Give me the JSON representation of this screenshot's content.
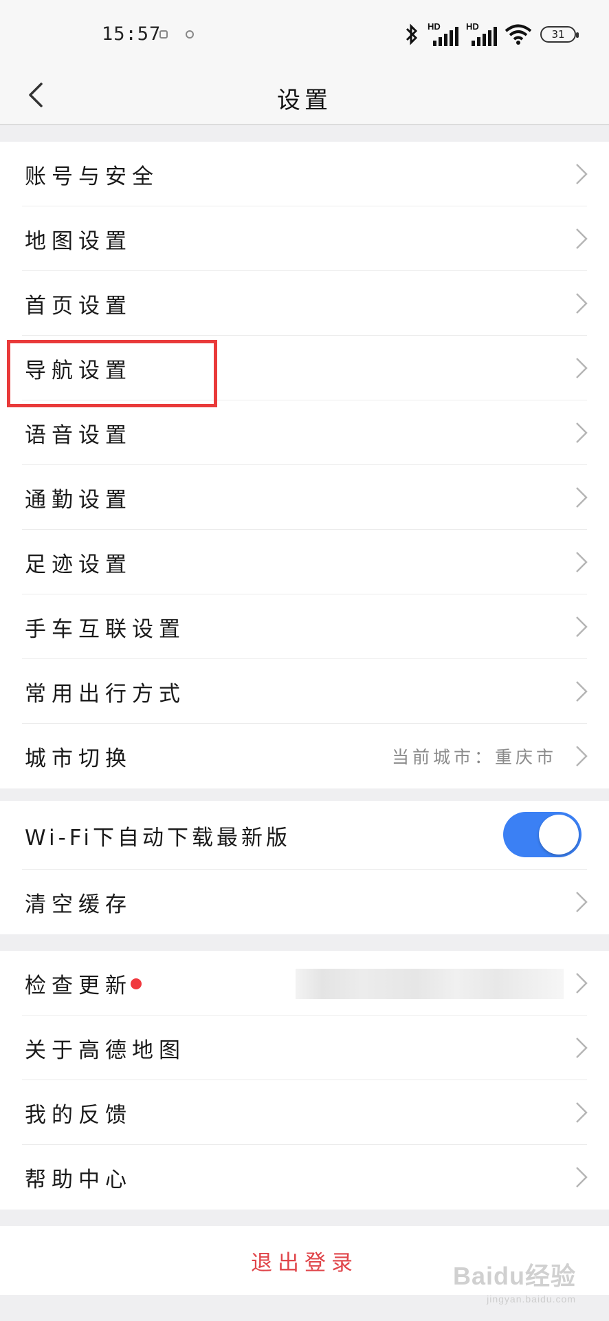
{
  "status_bar": {
    "time": "15:57",
    "battery": "31",
    "signal_label": "HD"
  },
  "header": {
    "title": "设置"
  },
  "groups": [
    {
      "rows": [
        {
          "label": "账号与安全"
        },
        {
          "label": "地图设置"
        },
        {
          "label": "首页设置"
        },
        {
          "label": "导航设置"
        },
        {
          "label": "语音设置"
        },
        {
          "label": "通勤设置"
        },
        {
          "label": "足迹设置"
        },
        {
          "label": "手车互联设置"
        },
        {
          "label": "常用出行方式"
        },
        {
          "label": "城市切换",
          "value": "当前城市：重庆市"
        }
      ]
    },
    {
      "rows": [
        {
          "label": "Wi-Fi下自动下载最新版",
          "toggle": true
        },
        {
          "label": "清空缓存"
        }
      ]
    },
    {
      "rows": [
        {
          "label": "检查更新",
          "badge": true
        },
        {
          "label": "关于高德地图"
        },
        {
          "label": "我的反馈"
        },
        {
          "label": "帮助中心"
        }
      ]
    }
  ],
  "logout": {
    "label": "退出登录"
  },
  "watermark": {
    "text": "Baidu经验",
    "sub": "jingyan.baidu.com"
  },
  "colors": {
    "accent": "#3b80f4",
    "danger": "#e0454a",
    "highlight": "#e93a3a"
  },
  "icons": {
    "back": "chevron-left-icon",
    "row": "chevron-right-icon"
  }
}
